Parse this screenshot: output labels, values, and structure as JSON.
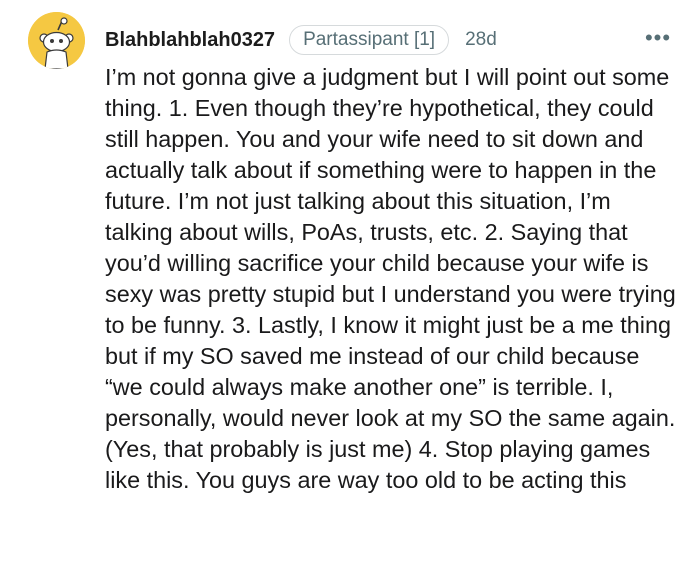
{
  "comment": {
    "avatar_icon": "snoo-avatar-icon",
    "avatar_color": "#f5c842",
    "username": "Blahblahblah0327",
    "flair": "Partassipant [1]",
    "age": "28d",
    "more_icon": "more-options-icon",
    "more_label": "•••",
    "body": "I’m not gonna give a judgment but I will point out some thing. 1. Even though they’re hypothetical, they could still happen. You and your wife need to sit down and actually talk about if something were to happen in the future. I’m not just talking about this situation, I’m talking about wills, PoAs, trusts, etc. 2. Saying that you’d willing sacrifice your child because your wife is sexy was pretty stupid but I understand you were trying to be funny. 3. Lastly, I know it might just be a me thing but if my SO saved me instead of our child because “we could always make another one” is terrible. I, personally, would never look at my SO the same again. (Yes, that probably is just me) 4. Stop playing games like this. You guys are way too old to be acting this"
  }
}
